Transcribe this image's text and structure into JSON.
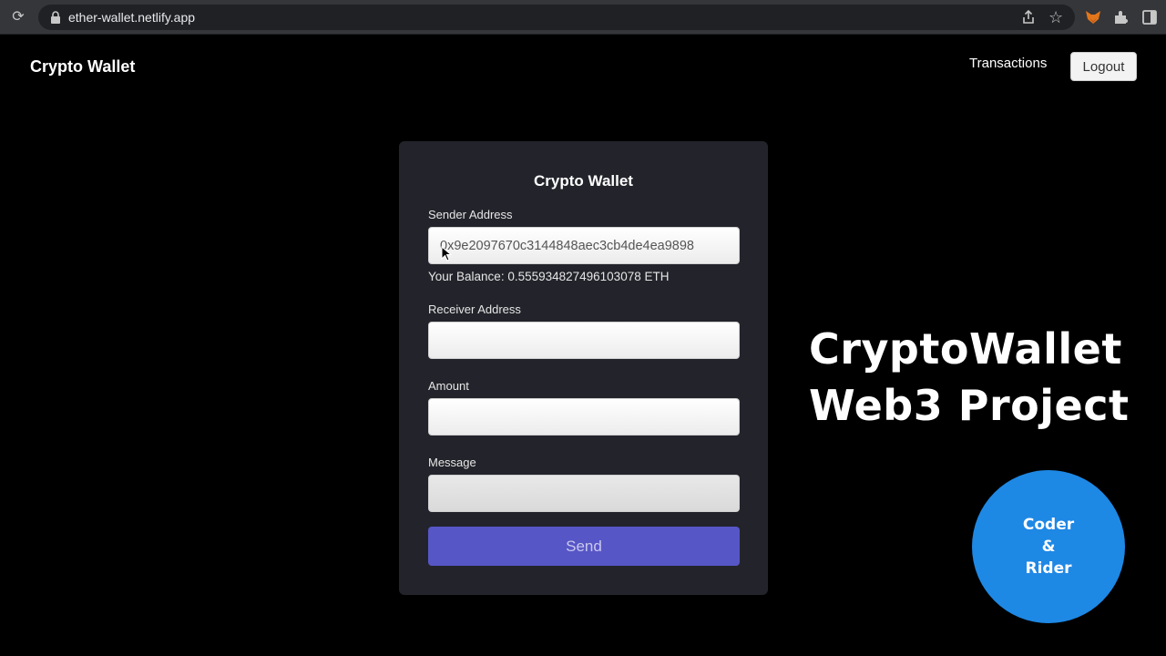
{
  "browser": {
    "url": "ether-wallet.netlify.app",
    "reload_glyph": "⟳",
    "star_glyph": "☆"
  },
  "header": {
    "brand": "Crypto Wallet",
    "nav_transactions": "Transactions",
    "logout_label": "Logout"
  },
  "form": {
    "title": "Crypto Wallet",
    "sender_label": "Sender Address",
    "sender_value": "0x9e2097670c3144848aec3cb4de4ea9898",
    "balance_text": "Your Balance: 0.555934827496103078 ETH",
    "receiver_label": "Receiver Address",
    "receiver_value": "",
    "amount_label": "Amount",
    "amount_value": "",
    "message_label": "Message",
    "message_value": "",
    "send_label": "Send"
  },
  "overlay": {
    "title_line1": "CryptoWallet",
    "title_line2": "Web3 Project",
    "badge_line1": "Coder",
    "badge_line2": "&",
    "badge_line3": "Rider"
  },
  "colors": {
    "page_bg": "#000000",
    "card_bg": "#23242b",
    "send_button": "#5756c6",
    "badge": "#1e88e5"
  },
  "icons": [
    "reload-icon",
    "lock-icon",
    "share-icon",
    "star-icon",
    "fox-extension-icon",
    "puzzle-extension-icon",
    "side-panel-icon",
    "mouse-cursor-icon"
  ]
}
